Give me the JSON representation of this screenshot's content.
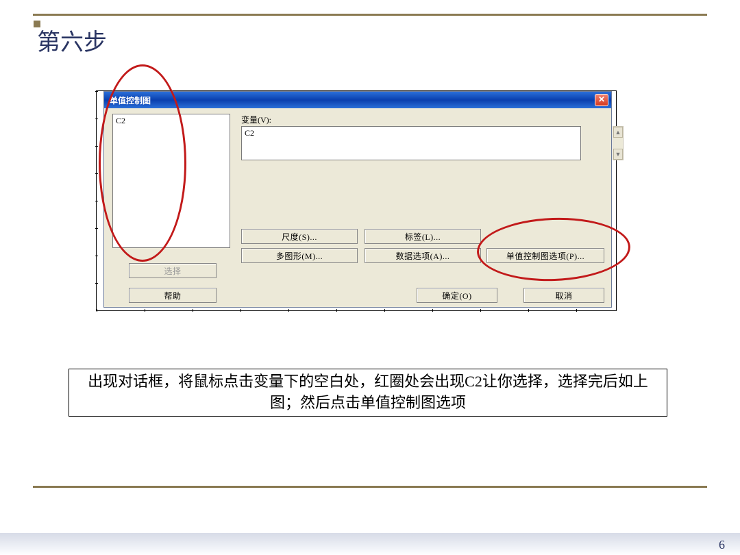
{
  "slide": {
    "title": "第六步",
    "caption": "出现对话框，将鼠标点击变量下的空白处，红圈处会出现C2让你选择，选择完后如上图；然后点击单值控制图选项",
    "page_number": "6"
  },
  "dialog": {
    "title": "单值控制图",
    "close_glyph": "✕",
    "listbox_value": "C2",
    "var_label": "变量(V):",
    "var_value": "C2",
    "buttons": {
      "scale": "尺度(S)...",
      "label": "标签(L)...",
      "multi": "多图形(M)...",
      "data": "数据选项(A)...",
      "opt": "单值控制图选项(P)...",
      "select": "选择",
      "help": "帮助",
      "ok": "确定(O)",
      "cancel": "取消"
    },
    "scroll": {
      "up": "▲",
      "down": "▼"
    }
  }
}
